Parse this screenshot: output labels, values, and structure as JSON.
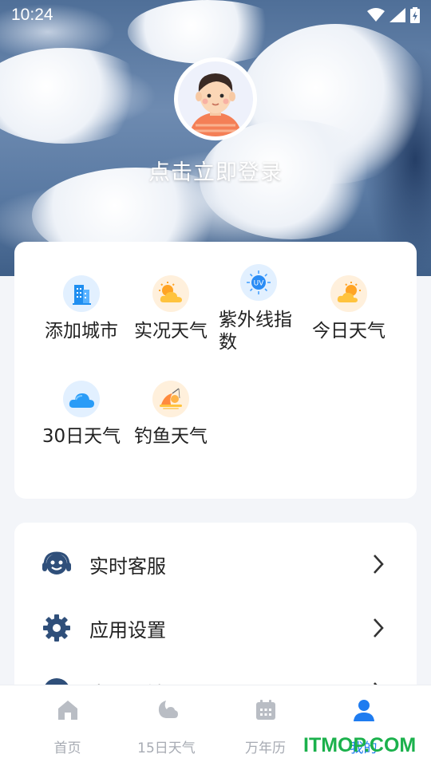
{
  "status_bar": {
    "time": "10:24"
  },
  "header": {
    "login_prompt": "点击立即登录"
  },
  "features": [
    {
      "label": "添加城市",
      "icon": "city-buildings-icon"
    },
    {
      "label": "实况天气",
      "icon": "sun-cloud-icon"
    },
    {
      "label": "紫外线指数",
      "icon": "uv-sun-icon"
    },
    {
      "label": "今日天气",
      "icon": "sun-cloud-icon"
    },
    {
      "label": "30日天气",
      "icon": "cloud-icon"
    },
    {
      "label": "钓鱼天气",
      "icon": "fishing-sunset-icon"
    }
  ],
  "uv_badge": "UV",
  "menu": [
    {
      "label": "实时客服",
      "icon": "headset-support-icon"
    },
    {
      "label": "应用设置",
      "icon": "gear-icon"
    },
    {
      "label": "意见反馈",
      "icon": "feedback-icon"
    }
  ],
  "bottom_nav": [
    {
      "label": "首页",
      "icon": "home-icon",
      "active": false
    },
    {
      "label": "15日天气",
      "icon": "moon-cloud-icon",
      "active": false
    },
    {
      "label": "万年历",
      "icon": "calendar-icon",
      "active": false
    },
    {
      "label": "我的",
      "icon": "user-icon",
      "active": true
    }
  ],
  "watermark": "ITMOP.COM",
  "colors": {
    "accent": "#1f7cf0",
    "menu_icon": "#2f4f7a",
    "inactive_nav": "#a7abb3",
    "watermark": "#1bb14c"
  }
}
